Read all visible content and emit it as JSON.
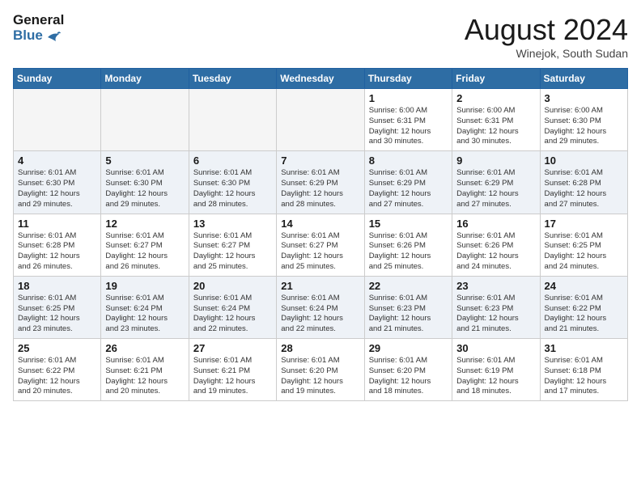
{
  "header": {
    "logo_line1": "General",
    "logo_line2": "Blue",
    "month_year": "August 2024",
    "location": "Winejok, South Sudan"
  },
  "weekdays": [
    "Sunday",
    "Monday",
    "Tuesday",
    "Wednesday",
    "Thursday",
    "Friday",
    "Saturday"
  ],
  "weeks": [
    [
      {
        "day": "",
        "info": ""
      },
      {
        "day": "",
        "info": ""
      },
      {
        "day": "",
        "info": ""
      },
      {
        "day": "",
        "info": ""
      },
      {
        "day": "1",
        "info": "Sunrise: 6:00 AM\nSunset: 6:31 PM\nDaylight: 12 hours\nand 30 minutes."
      },
      {
        "day": "2",
        "info": "Sunrise: 6:00 AM\nSunset: 6:31 PM\nDaylight: 12 hours\nand 30 minutes."
      },
      {
        "day": "3",
        "info": "Sunrise: 6:00 AM\nSunset: 6:30 PM\nDaylight: 12 hours\nand 29 minutes."
      }
    ],
    [
      {
        "day": "4",
        "info": "Sunrise: 6:01 AM\nSunset: 6:30 PM\nDaylight: 12 hours\nand 29 minutes."
      },
      {
        "day": "5",
        "info": "Sunrise: 6:01 AM\nSunset: 6:30 PM\nDaylight: 12 hours\nand 29 minutes."
      },
      {
        "day": "6",
        "info": "Sunrise: 6:01 AM\nSunset: 6:30 PM\nDaylight: 12 hours\nand 28 minutes."
      },
      {
        "day": "7",
        "info": "Sunrise: 6:01 AM\nSunset: 6:29 PM\nDaylight: 12 hours\nand 28 minutes."
      },
      {
        "day": "8",
        "info": "Sunrise: 6:01 AM\nSunset: 6:29 PM\nDaylight: 12 hours\nand 27 minutes."
      },
      {
        "day": "9",
        "info": "Sunrise: 6:01 AM\nSunset: 6:29 PM\nDaylight: 12 hours\nand 27 minutes."
      },
      {
        "day": "10",
        "info": "Sunrise: 6:01 AM\nSunset: 6:28 PM\nDaylight: 12 hours\nand 27 minutes."
      }
    ],
    [
      {
        "day": "11",
        "info": "Sunrise: 6:01 AM\nSunset: 6:28 PM\nDaylight: 12 hours\nand 26 minutes."
      },
      {
        "day": "12",
        "info": "Sunrise: 6:01 AM\nSunset: 6:27 PM\nDaylight: 12 hours\nand 26 minutes."
      },
      {
        "day": "13",
        "info": "Sunrise: 6:01 AM\nSunset: 6:27 PM\nDaylight: 12 hours\nand 25 minutes."
      },
      {
        "day": "14",
        "info": "Sunrise: 6:01 AM\nSunset: 6:27 PM\nDaylight: 12 hours\nand 25 minutes."
      },
      {
        "day": "15",
        "info": "Sunrise: 6:01 AM\nSunset: 6:26 PM\nDaylight: 12 hours\nand 25 minutes."
      },
      {
        "day": "16",
        "info": "Sunrise: 6:01 AM\nSunset: 6:26 PM\nDaylight: 12 hours\nand 24 minutes."
      },
      {
        "day": "17",
        "info": "Sunrise: 6:01 AM\nSunset: 6:25 PM\nDaylight: 12 hours\nand 24 minutes."
      }
    ],
    [
      {
        "day": "18",
        "info": "Sunrise: 6:01 AM\nSunset: 6:25 PM\nDaylight: 12 hours\nand 23 minutes."
      },
      {
        "day": "19",
        "info": "Sunrise: 6:01 AM\nSunset: 6:24 PM\nDaylight: 12 hours\nand 23 minutes."
      },
      {
        "day": "20",
        "info": "Sunrise: 6:01 AM\nSunset: 6:24 PM\nDaylight: 12 hours\nand 22 minutes."
      },
      {
        "day": "21",
        "info": "Sunrise: 6:01 AM\nSunset: 6:24 PM\nDaylight: 12 hours\nand 22 minutes."
      },
      {
        "day": "22",
        "info": "Sunrise: 6:01 AM\nSunset: 6:23 PM\nDaylight: 12 hours\nand 21 minutes."
      },
      {
        "day": "23",
        "info": "Sunrise: 6:01 AM\nSunset: 6:23 PM\nDaylight: 12 hours\nand 21 minutes."
      },
      {
        "day": "24",
        "info": "Sunrise: 6:01 AM\nSunset: 6:22 PM\nDaylight: 12 hours\nand 21 minutes."
      }
    ],
    [
      {
        "day": "25",
        "info": "Sunrise: 6:01 AM\nSunset: 6:22 PM\nDaylight: 12 hours\nand 20 minutes."
      },
      {
        "day": "26",
        "info": "Sunrise: 6:01 AM\nSunset: 6:21 PM\nDaylight: 12 hours\nand 20 minutes."
      },
      {
        "day": "27",
        "info": "Sunrise: 6:01 AM\nSunset: 6:21 PM\nDaylight: 12 hours\nand 19 minutes."
      },
      {
        "day": "28",
        "info": "Sunrise: 6:01 AM\nSunset: 6:20 PM\nDaylight: 12 hours\nand 19 minutes."
      },
      {
        "day": "29",
        "info": "Sunrise: 6:01 AM\nSunset: 6:20 PM\nDaylight: 12 hours\nand 18 minutes."
      },
      {
        "day": "30",
        "info": "Sunrise: 6:01 AM\nSunset: 6:19 PM\nDaylight: 12 hours\nand 18 minutes."
      },
      {
        "day": "31",
        "info": "Sunrise: 6:01 AM\nSunset: 6:18 PM\nDaylight: 12 hours\nand 17 minutes."
      }
    ]
  ]
}
